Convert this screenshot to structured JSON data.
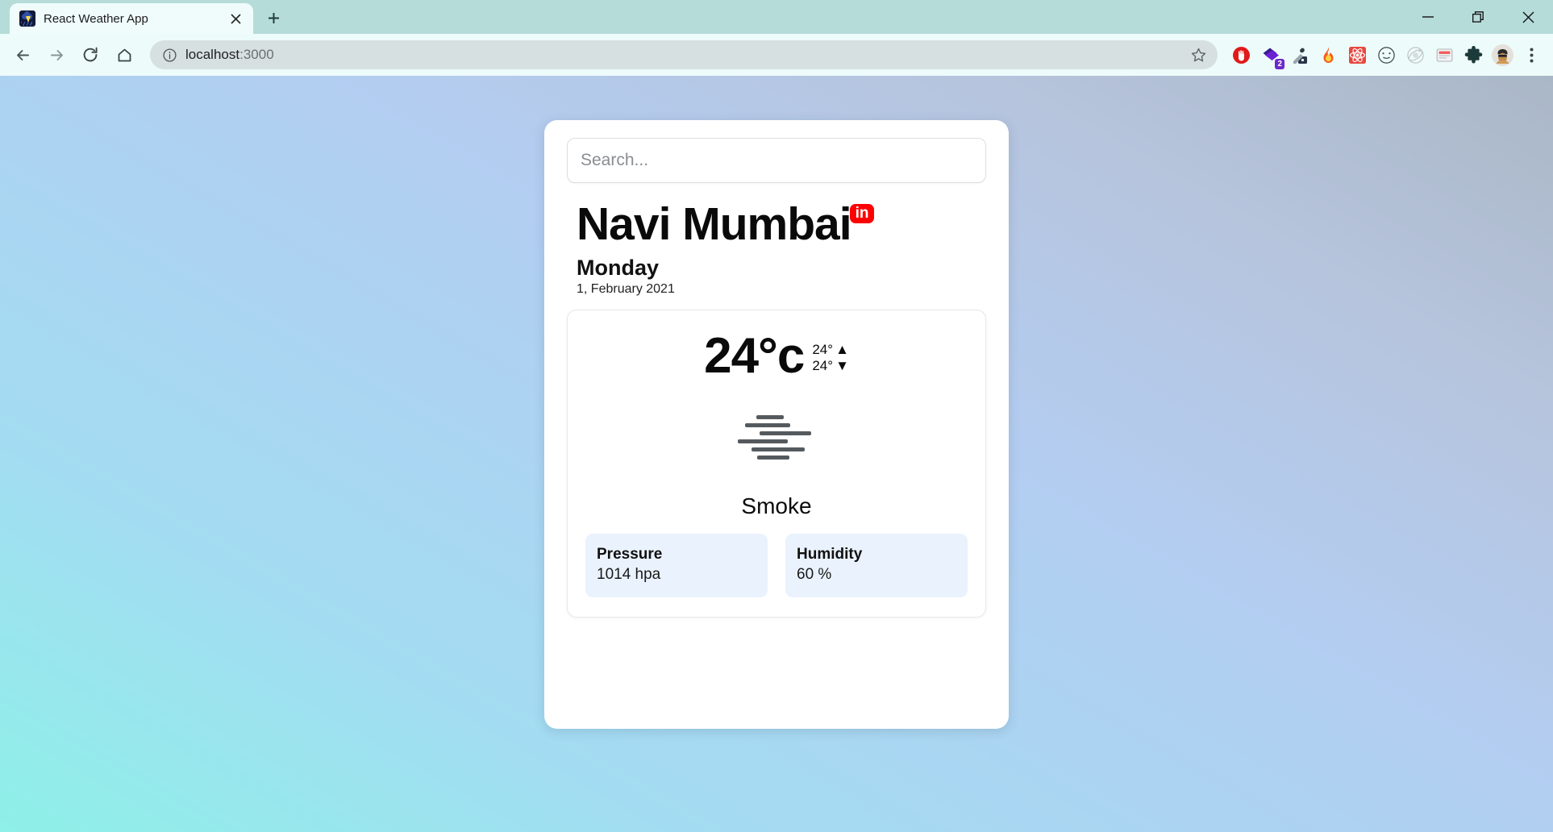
{
  "browser": {
    "tab": {
      "title": "React Weather App",
      "favicon_icon": "thunderstorm-cloud-icon",
      "close_icon": "close-icon"
    },
    "new_tab_icon": "plus-icon",
    "window_controls": {
      "minimize_icon": "minimize-icon",
      "restore_icon": "restore-icon",
      "close_icon": "close-icon"
    },
    "nav": {
      "back_icon": "arrow-left-icon",
      "forward_icon": "arrow-right-icon",
      "reload_icon": "reload-icon",
      "home_icon": "home-icon"
    },
    "omnibox": {
      "info_icon": "info-circle-icon",
      "host": "localhost",
      "port": ":3000",
      "bookmark_icon": "star-icon"
    },
    "extensions": [
      {
        "name": "adblock-icon",
        "badge": ""
      },
      {
        "name": "purple-diamond-icon",
        "badge": "2"
      },
      {
        "name": "eyedropper-icon",
        "badge": ""
      },
      {
        "name": "fire-emoji-icon",
        "badge": ""
      },
      {
        "name": "react-devtools-icon",
        "badge": ""
      },
      {
        "name": "smiley-circle-icon",
        "badge": ""
      },
      {
        "name": "orbit-icon",
        "badge": ""
      },
      {
        "name": "notes-icon",
        "badge": ""
      },
      {
        "name": "puzzle-piece-icon",
        "badge": ""
      }
    ],
    "profile_icon": "avatar-icon",
    "menu_icon": "three-dot-menu-icon"
  },
  "app": {
    "search": {
      "placeholder": "Search...",
      "value": ""
    },
    "location": {
      "city": "Navi Mumbai",
      "country_code": "in"
    },
    "date": {
      "day": "Monday",
      "full": "1, February 2021"
    },
    "weather": {
      "temperature": "24°c",
      "high": "24°",
      "high_arrow": "▲",
      "low": "24°",
      "low_arrow": "▼",
      "condition": "Smoke",
      "condition_icon": "smoke-haze-icon",
      "metrics": [
        {
          "label": "Pressure",
          "value": "1014 hpa"
        },
        {
          "label": "Humidity",
          "value": "60 %"
        }
      ]
    }
  },
  "colors": {
    "tabstrip": "#b6dcd9",
    "toolbar": "#eefbfb",
    "badge_red": "#ff0000",
    "metric_bg": "#eaf2fd",
    "gradient_from": "#8ef0e8",
    "gradient_to": "#aab7c6"
  }
}
